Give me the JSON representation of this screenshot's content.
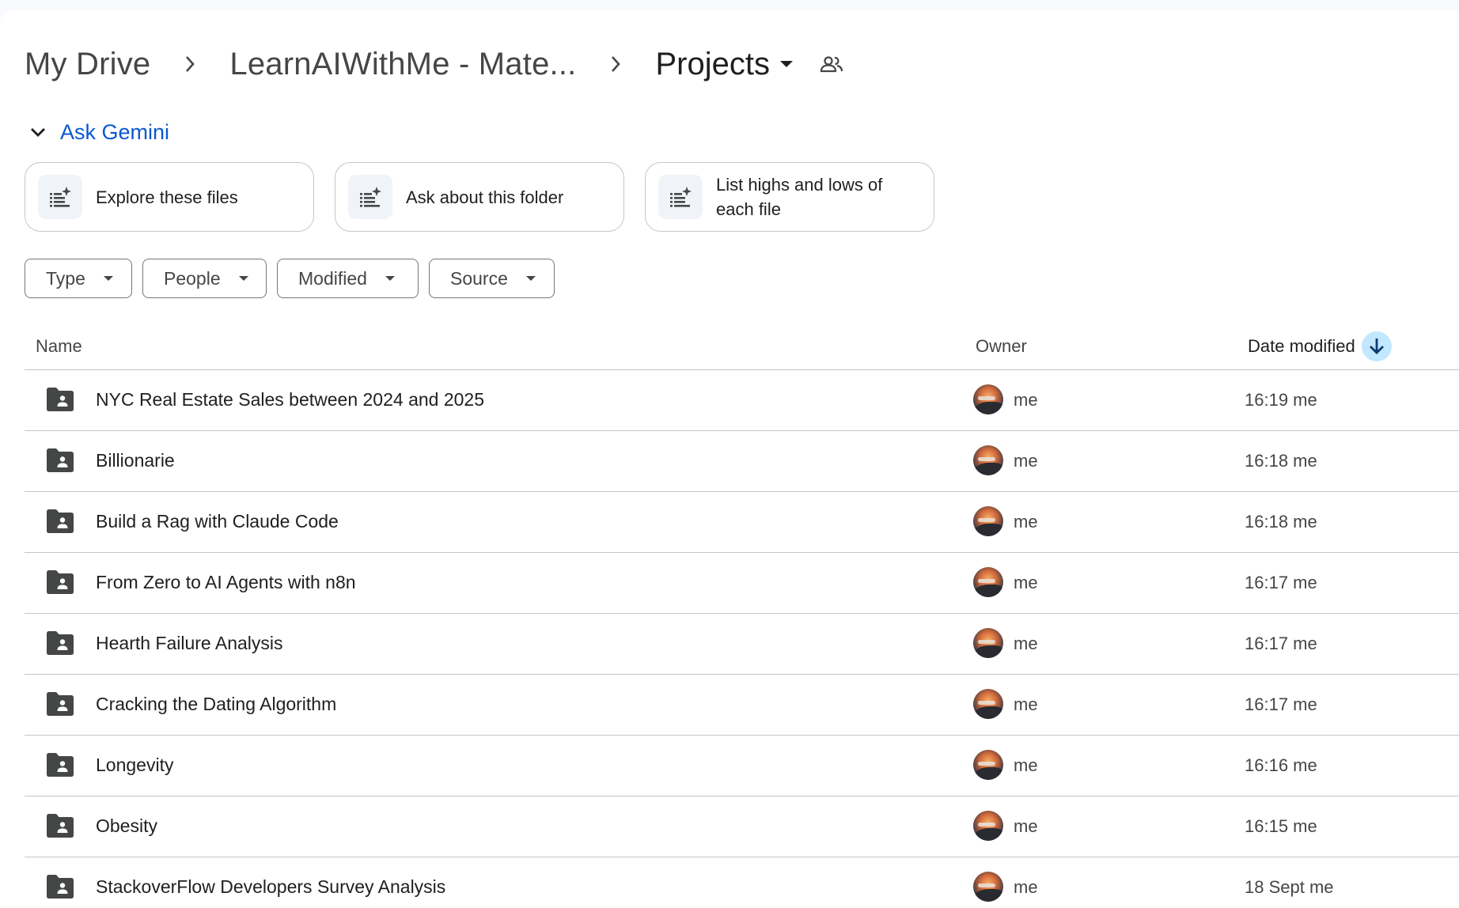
{
  "breadcrumb": {
    "root": "My Drive",
    "parent": "LearnAIWithMe - Mate...",
    "current": "Projects"
  },
  "gemini": {
    "label": "Ask Gemini",
    "suggestions": [
      {
        "label": "Explore these files"
      },
      {
        "label": "Ask about this folder"
      },
      {
        "label": "List highs and lows of each file"
      }
    ]
  },
  "filters": [
    {
      "label": "Type"
    },
    {
      "label": "People"
    },
    {
      "label": "Modified"
    },
    {
      "label": "Source"
    }
  ],
  "table": {
    "headers": {
      "name": "Name",
      "owner": "Owner",
      "date_modified": "Date modified"
    },
    "rows": [
      {
        "name": "NYC Real Estate Sales between 2024 and 2025",
        "owner": "me",
        "modified": "16:19 me"
      },
      {
        "name": "Billionarie",
        "owner": "me",
        "modified": "16:18 me"
      },
      {
        "name": "Build a Rag with Claude Code",
        "owner": "me",
        "modified": "16:18 me"
      },
      {
        "name": "From Zero to AI Agents with n8n",
        "owner": "me",
        "modified": "16:17 me"
      },
      {
        "name": "Hearth Failure Analysis",
        "owner": "me",
        "modified": "16:17 me"
      },
      {
        "name": "Cracking the Dating Algorithm",
        "owner": "me",
        "modified": "16:17 me"
      },
      {
        "name": "Longevity",
        "owner": "me",
        "modified": "16:16 me"
      },
      {
        "name": "Obesity",
        "owner": "me",
        "modified": "16:15 me"
      },
      {
        "name": "StackoverFlow Developers Survey Analysis",
        "owner": "me",
        "modified": "18 Sept me"
      }
    ]
  },
  "icons": {
    "folder": "shared-folder-icon",
    "sort": "arrow-down-icon",
    "suggestion": "sparkle-list-icon",
    "shared": "people-icon"
  },
  "colors": {
    "accent": "#0b57d0",
    "sort_chip": "#c2e7ff",
    "folder": "#444746"
  }
}
